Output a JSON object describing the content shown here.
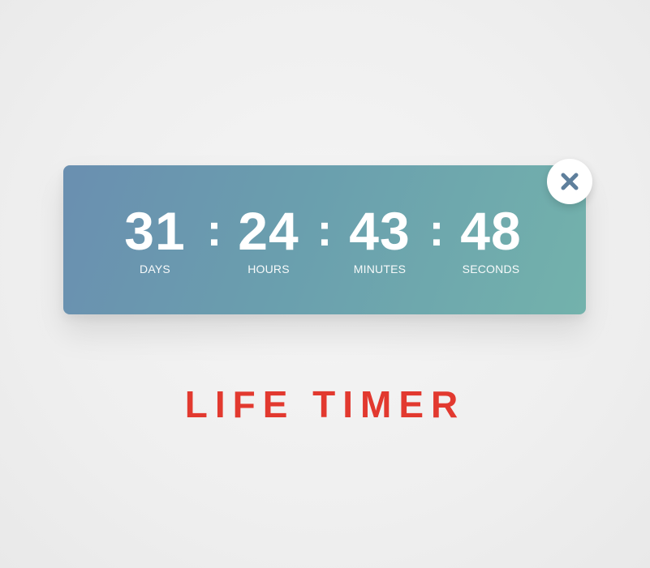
{
  "timer": {
    "days": {
      "value": "31",
      "label": "DAYS"
    },
    "hours": {
      "value": "24",
      "label": "HOURS"
    },
    "minutes": {
      "value": "43",
      "label": "MINUTES"
    },
    "seconds": {
      "value": "48",
      "label": "SECONDS"
    },
    "separator": ":"
  },
  "close_button": {
    "icon": "close-icon"
  },
  "title": "LIFE TIMER",
  "colors": {
    "card_gradient_start": "#6a8fb0",
    "card_gradient_end": "#73b2ac",
    "close_icon": "#5e7f9c",
    "title_red": "#e2392f",
    "background": "#f0f0f0"
  }
}
